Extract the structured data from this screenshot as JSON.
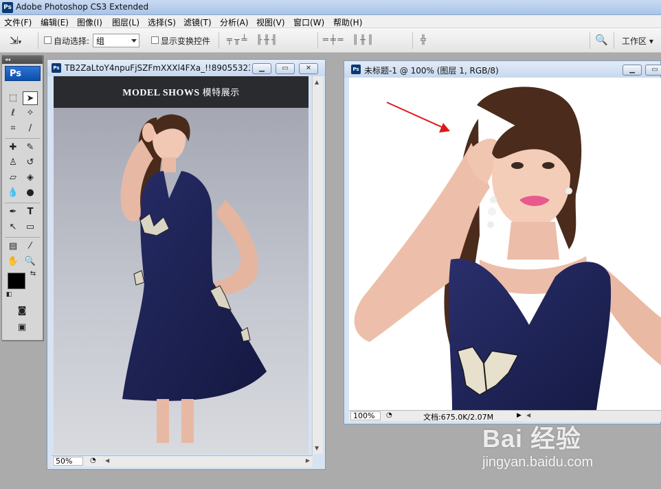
{
  "app": {
    "title": "Adobe Photoshop CS3 Extended",
    "logo_text": "Ps"
  },
  "menu": [
    "文件(F)",
    "编辑(E)",
    "图像(I)",
    "图层(L)",
    "选择(S)",
    "滤镜(T)",
    "分析(A)",
    "视图(V)",
    "窗口(W)",
    "帮助(H)"
  ],
  "options": {
    "auto_select_label": "自动选择:",
    "auto_select_value": "组",
    "show_transform_label": "显示变换控件",
    "workspace_label": "工作区"
  },
  "toolbox": {
    "logo_text": "Ps"
  },
  "doc1": {
    "title": "TB2ZaLtoY4npuFjSZFmXXXl4FXa_!!89055323...",
    "zoom": "50%",
    "header_en": "MODEL SHOWS",
    "header_cn": "模特展示"
  },
  "doc2": {
    "title": "未标题-1 @ 100% (图层 1, RGB/8)",
    "zoom": "100%",
    "doc_info": "文档:675.0K/2.07M"
  },
  "watermark": {
    "brand": "Bai 经验",
    "site": "jingyan.baidu.com"
  },
  "colors": {
    "dress": "#1b2150",
    "title_bar": "#c9dbf2",
    "arrow": "#e01818"
  }
}
